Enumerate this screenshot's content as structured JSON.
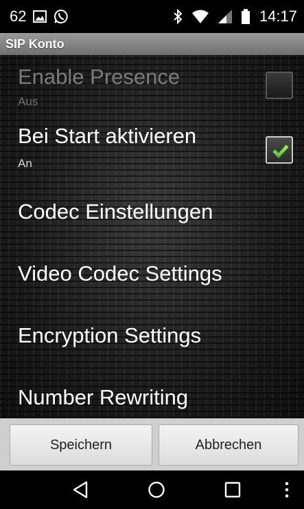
{
  "status_bar": {
    "notification_count": "62",
    "icons": [
      "image-icon",
      "whatsapp-icon",
      "bluetooth-icon",
      "wifi-icon",
      "signal-icon",
      "battery-icon"
    ],
    "time": "14:17"
  },
  "title_bar": {
    "title": "SIP Konto"
  },
  "settings": {
    "items": [
      {
        "title": "Enable Presence",
        "subtitle": "Aus",
        "enabled": false,
        "checkbox": true,
        "checked": false
      },
      {
        "title": "Bei Start aktivieren",
        "subtitle": "An",
        "enabled": true,
        "checkbox": true,
        "checked": true
      },
      {
        "title": "Codec Einstellungen"
      },
      {
        "title": "Video Codec Settings"
      },
      {
        "title": "Encryption Settings"
      },
      {
        "title": "Number Rewriting"
      }
    ]
  },
  "buttons": {
    "save_label": "Speichern",
    "cancel_label": "Abbrechen"
  },
  "nav_bar": {
    "icons": [
      "back-icon",
      "home-icon",
      "recents-icon",
      "menu-icon"
    ]
  },
  "colors": {
    "check_accent": "#7ed957",
    "title_bar": "#8a8a8a",
    "button_bar": "#cfcfcf"
  }
}
